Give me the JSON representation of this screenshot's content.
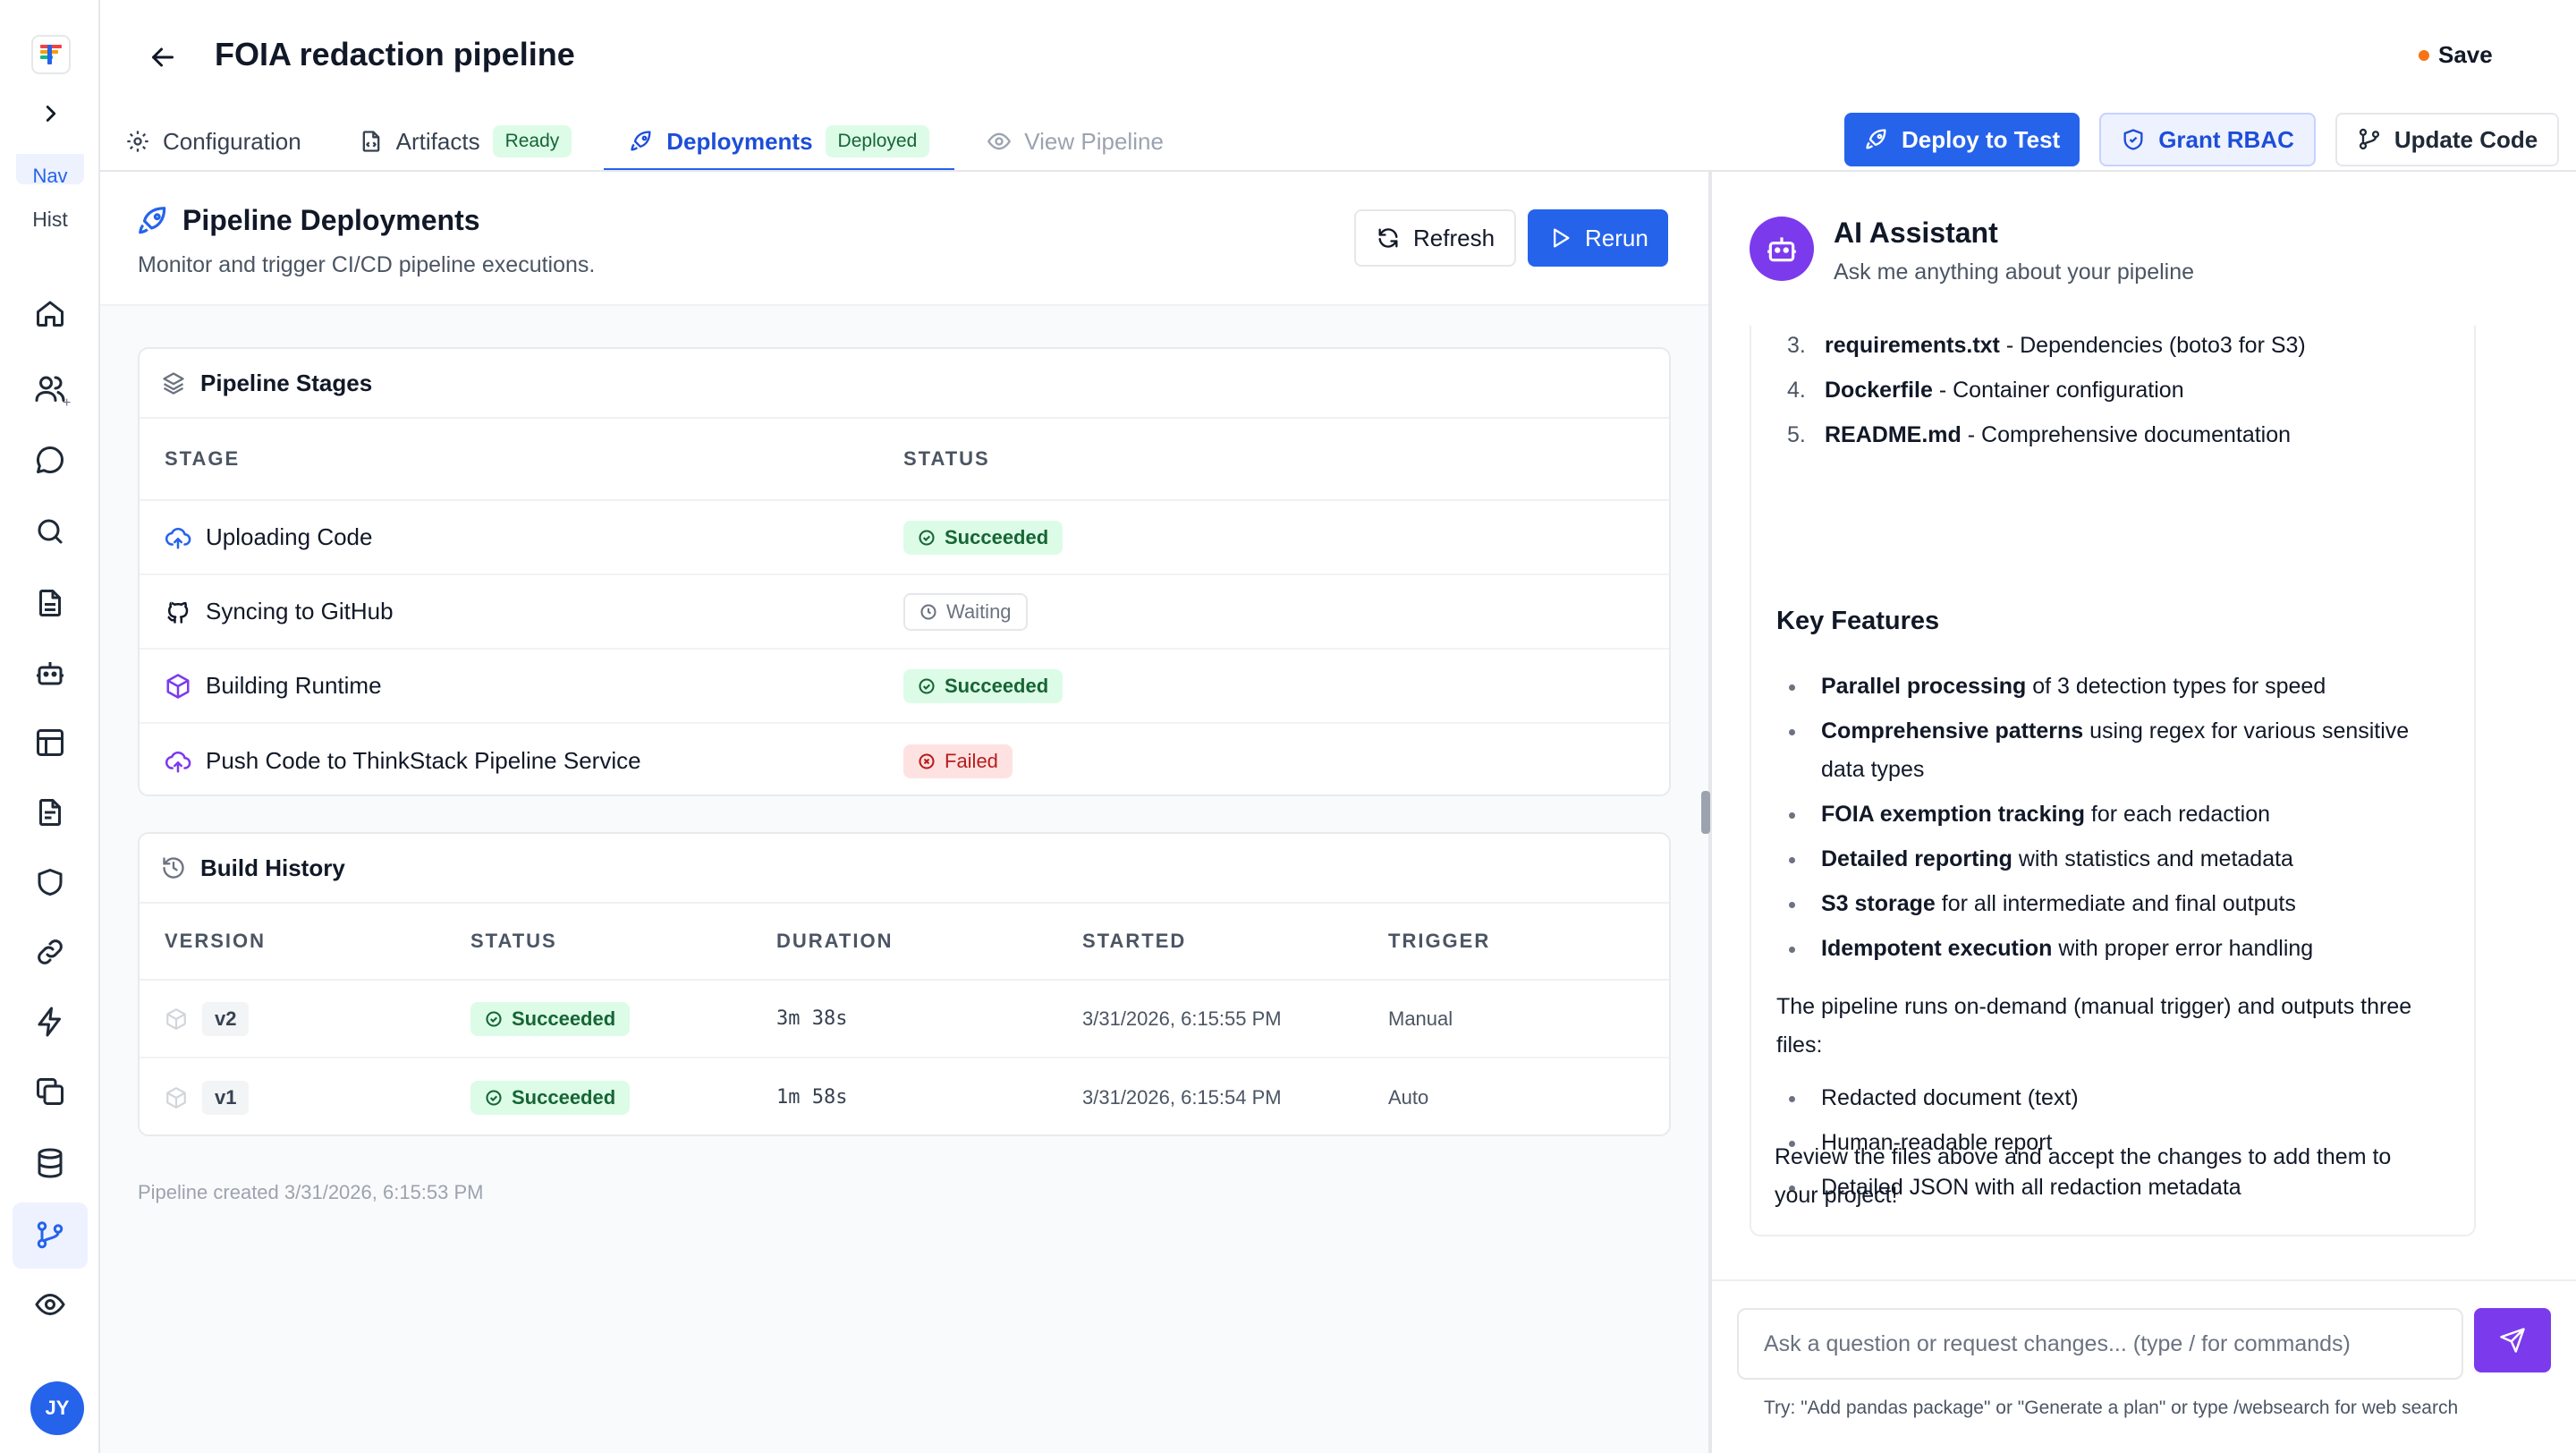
{
  "rail": {
    "nav_label": "Nav",
    "hist_label": "Hist",
    "avatar_initials": "JY"
  },
  "header": {
    "title": "FOIA redaction pipeline",
    "save_label": "Save"
  },
  "tabs": [
    {
      "label": "Configuration",
      "icon": "gear-icon"
    },
    {
      "label": "Artifacts",
      "badge": "Ready",
      "icon": "file-code-icon"
    },
    {
      "label": "Deployments",
      "badge": "Deployed",
      "icon": "rocket-icon"
    },
    {
      "label": "View Pipeline",
      "icon": "eye-icon"
    }
  ],
  "actions": {
    "deploy": "Deploy to Test",
    "grant": "Grant RBAC",
    "update": "Update Code"
  },
  "main": {
    "title": "Pipeline Deployments",
    "subtitle": "Monitor and trigger CI/CD pipeline executions.",
    "refresh_label": "Refresh",
    "rerun_label": "Rerun",
    "created_note": "Pipeline created 3/31/2026, 6:15:53 PM"
  },
  "stages": {
    "title": "Pipeline Stages",
    "col_stage": "STAGE",
    "col_status": "STATUS",
    "rows": [
      {
        "name": "Uploading Code",
        "status": "Succeeded",
        "icon": "cloud-upload-icon"
      },
      {
        "name": "Syncing to GitHub",
        "status": "Waiting",
        "icon": "github-icon"
      },
      {
        "name": "Building Runtime",
        "status": "Succeeded",
        "icon": "package-icon"
      },
      {
        "name": "Push Code to ThinkStack Pipeline Service",
        "status": "Failed",
        "icon": "cloud-upload-icon"
      }
    ]
  },
  "builds": {
    "title": "Build History",
    "cols": [
      "VERSION",
      "STATUS",
      "DURATION",
      "STARTED",
      "TRIGGER"
    ],
    "rows": [
      {
        "version": "v2",
        "status": "Succeeded",
        "duration": "3m 38s",
        "started": "3/31/2026, 6:15:55 PM",
        "trigger": "Manual"
      },
      {
        "version": "v1",
        "status": "Succeeded",
        "duration": "1m 58s",
        "started": "3/31/2026, 6:15:54 PM",
        "trigger": "Auto"
      }
    ]
  },
  "assistant": {
    "title": "AI Assistant",
    "subtitle": "Ask me anything about your pipeline",
    "files": [
      {
        "n": "3.",
        "name": "requirements.txt",
        "desc": " - Dependencies (boto3 for S3)"
      },
      {
        "n": "4.",
        "name": "Dockerfile",
        "desc": " - Container configuration"
      },
      {
        "n": "5.",
        "name": "README.md",
        "desc": " - Comprehensive documentation"
      }
    ],
    "features_title": "Key Features",
    "features": [
      {
        "bold": "Parallel processing",
        "rest": " of 3 detection types for speed"
      },
      {
        "bold": "Comprehensive patterns",
        "rest": " using regex for various sensitive data types"
      },
      {
        "bold": "FOIA exemption tracking",
        "rest": " for each redaction"
      },
      {
        "bold": "Detailed reporting",
        "rest": " with statistics and metadata"
      },
      {
        "bold": "S3 storage",
        "rest": " for all intermediate and final outputs"
      },
      {
        "bold": "Idempotent execution",
        "rest": " with proper error handling"
      }
    ],
    "runs_text": "The pipeline runs on-demand (manual trigger) and outputs three files:",
    "outputs": [
      "Redacted document (text)",
      "Human-readable report",
      "Detailed JSON with all redaction metadata"
    ],
    "closing": "Review the files above and accept the changes to add them to your project!",
    "input_placeholder": "Ask a question or request changes... (type / for commands)",
    "hint": "Try: \"Add pandas package\" or \"Generate a plan\" or type /websearch for web search"
  },
  "colors": {
    "primary": "#2563eb",
    "assistant": "#7c3aed",
    "success_bg": "#dcfce7",
    "failed_bg": "#fee2e2",
    "unsaved_dot": "#f97316"
  }
}
